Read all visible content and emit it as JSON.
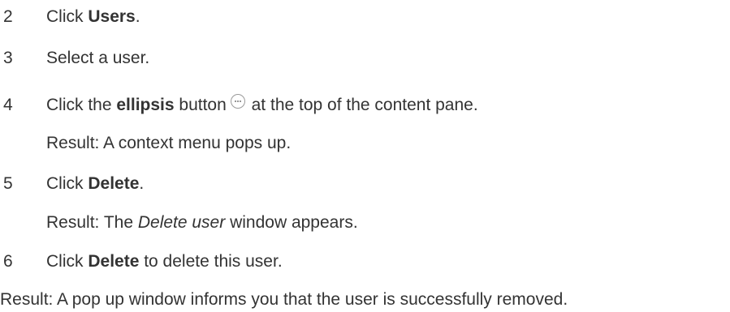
{
  "steps": [
    {
      "number": "2",
      "parts": {
        "a": "Click ",
        "b": "Users",
        "c": "."
      }
    },
    {
      "number": "3",
      "text": "Select a user."
    },
    {
      "number": "4",
      "parts": {
        "a": "Click the ",
        "b": "ellipsis",
        "c": " button",
        "d": " at the top of the content pane."
      },
      "icon": "ellipsis-icon",
      "result": "Result: A context menu pops up."
    },
    {
      "number": "5",
      "parts": {
        "a": "Click ",
        "b": "Delete",
        "c": "."
      },
      "result_parts": {
        "a": "Result: The ",
        "b": "Delete user",
        "c": " window appears."
      }
    },
    {
      "number": "6",
      "parts": {
        "a": "Click ",
        "b": "Delete",
        "c": " to delete this user."
      }
    }
  ],
  "final_result": "Result: A pop up window informs you that the user is successfully removed.",
  "colors": {
    "text": "#333333",
    "icon_border": "#9a9a9a"
  }
}
